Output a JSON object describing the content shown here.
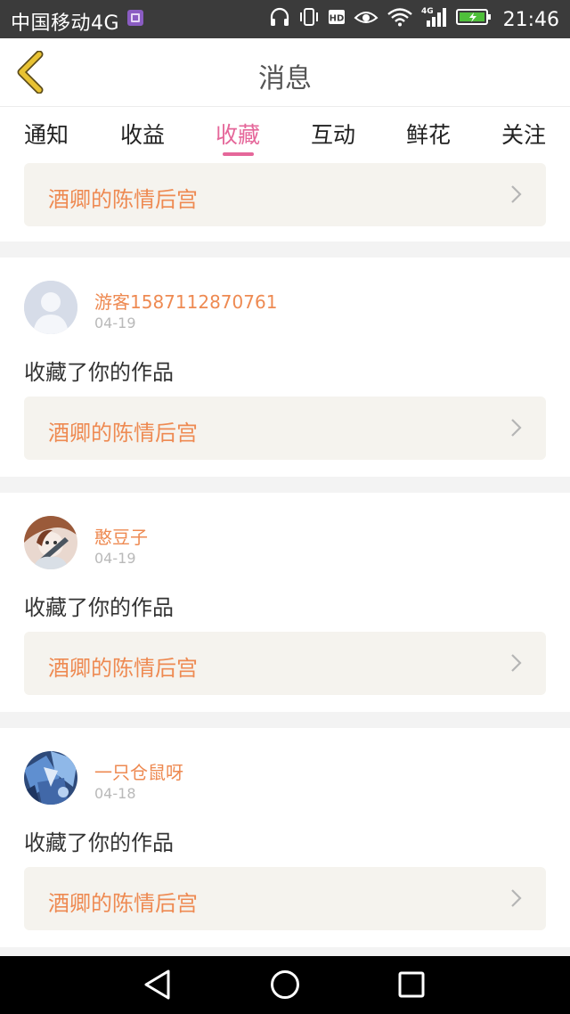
{
  "status_bar": {
    "carrier": "中国移动4G",
    "network": "4G",
    "hd_label": "HD",
    "time": "21:46"
  },
  "header": {
    "title": "消息"
  },
  "tabs": [
    {
      "label": "通知",
      "active": false
    },
    {
      "label": "收益",
      "active": false
    },
    {
      "label": "收藏",
      "active": true
    },
    {
      "label": "互动",
      "active": false
    },
    {
      "label": "鲜花",
      "active": false
    },
    {
      "label": "关注",
      "active": false
    }
  ],
  "top_card": {
    "work_title": "酒卿的陈情后宫"
  },
  "entries": [
    {
      "username": "游客1587112870761",
      "date": "04-19",
      "action": "收藏了你的作品",
      "work_title": "酒卿的陈情后宫",
      "avatar": "default-avatar"
    },
    {
      "username": "憨豆子",
      "date": "04-19",
      "action": "收藏了你的作品",
      "work_title": "酒卿的陈情后宫",
      "avatar": "anime-avatar"
    },
    {
      "username": "一只仓鼠呀",
      "date": "04-18",
      "action": "收藏了你的作品",
      "work_title": "酒卿的陈情后宫",
      "avatar": "blue-art-avatar"
    }
  ],
  "colors": {
    "accent_pink": "#e5679a",
    "accent_orange": "#ee8a52",
    "back_arrow": "#e8c233",
    "card_bg": "#f5f3ee"
  },
  "icons": {
    "back": "chevron-left-icon",
    "card_chevron": "chevron-right-icon",
    "nav_back": "triangle-back-icon",
    "nav_home": "circle-home-icon",
    "nav_recent": "square-recent-icon"
  }
}
